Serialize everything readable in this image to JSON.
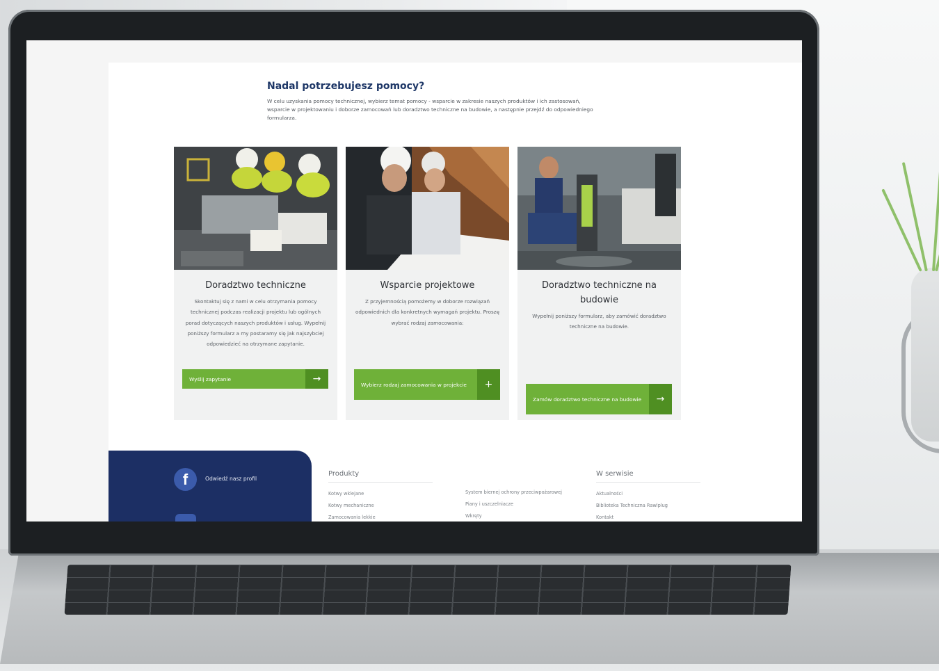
{
  "help": {
    "title": "Nadal potrzebujesz pomocy?",
    "description": "W celu uzyskania pomocy technicznej, wybierz temat pomocy - wsparcie w zakresie naszych produktów i ich zastosowań, wsparcie w projektowaniu i doborze zamocowań lub doradztwo techniczne na budowie, a następnie przejdź do odpowiedniego formularza."
  },
  "cards": [
    {
      "title": "Doradztwo techniczne",
      "text": "Skontaktuj się z nami w celu otrzymania pomocy technicznej podczas realizacji projektu lub ogólnych porad dotyczących naszych produktów i usług. Wypełnij poniższy formularz a my postaramy się jak najszybciej odpowiedzieć na otrzymane zapytanie.",
      "button": "Wyślij zapytanie",
      "button_icon": "→"
    },
    {
      "title": "Wsparcie projektowe",
      "text": "Z przyjemnością pomożemy w doborze rozwiązań odpowiednich dla konkretnych wymagań projektu. Proszę wybrać rodzaj zamocowania:",
      "button": "Wybierz rodzaj zamocowania w projekcie",
      "button_icon": "+"
    },
    {
      "title": "Doradztwo techniczne na budowie",
      "text": "Wypełnij poniższy formularz, aby zamówić doradztwo techniczne na budowie.",
      "button": "Zamów doradztwo techniczne na budowie",
      "button_icon": "→"
    }
  ],
  "footer": {
    "social": {
      "facebook_label": "Odwiedź nasz profil"
    },
    "products": {
      "heading": "Produkty",
      "links_a": [
        "Kotwy wklejane",
        "Kotwy mechaniczne",
        "Zamocowania lekkie"
      ],
      "links_b": [
        "System biernej ochrony przeciwpożarowej",
        "Piany i uszczelniacze",
        "Wkręty"
      ]
    },
    "service": {
      "heading": "W serwisie",
      "links": [
        "Aktualności",
        "Biblioteka Techniczna Rawlplug",
        "Kontakt"
      ]
    }
  },
  "colors": {
    "brand_green": "#6fb139",
    "brand_green_dark": "#4f8f22",
    "navy": "#1c2f64",
    "title_blue": "#1e3767"
  },
  "icons": [
    "facebook-icon",
    "youtube-icon",
    "arrow-right-icon",
    "plus-icon"
  ]
}
